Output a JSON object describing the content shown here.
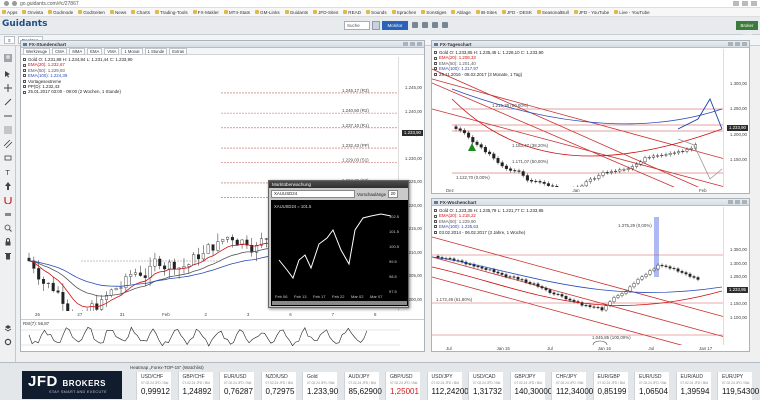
{
  "browser": {
    "url": "go.guidants.com/#c/27867",
    "bookmarks": [
      "Apps",
      "Onvista",
      "Godmode",
      "GodSeiten",
      "News",
      "Charts",
      "Trading-Tools",
      "FX-Makler",
      "MT4-Stats",
      "GM-Links",
      "Guidants",
      "JFD-Sites",
      "READ",
      "Sounds",
      "Sprachen",
      "Sonstiges",
      "Ablage",
      "IB-Sites",
      "JFD - DESK",
      "SeasonalBull",
      "JFD - YouTube",
      "Live - YouTube"
    ]
  },
  "app": {
    "logo": "Guidants",
    "search_placeholder": "Suche",
    "monitor_label": "Monitor",
    "broker_label": "Broker Login"
  },
  "toolbar": {
    "items": [
      "Desktop"
    ]
  },
  "panel_stunden": {
    "title": "FX-Stundenchart",
    "tools": [
      "Werkzeuge",
      "CMA",
      "MMA",
      "EMA",
      "VMA",
      "1 Monat",
      "1 Stunde",
      "Extras"
    ],
    "legend": [
      {
        "text": "Gold  O: 1.231,88  H: 1.234,84  L: 1.231,44  C: 1.233,90",
        "color": "#222222"
      },
      {
        "text": "EMA(20): 1.232,67",
        "color": "#d01010"
      },
      {
        "text": "EMA(50): 1.229,93",
        "color": "#555555"
      },
      {
        "text": "EMA(100): 1.224,39",
        "color": "#2a4ab8"
      },
      {
        "text": "Vortagesextreme",
        "color": "#222222"
      },
      {
        "text": "PP(D): 1.232,43",
        "color": "#222222"
      },
      {
        "text": "25.01.2017 03:00 - 09:00  (2 Wochen, 1 Stunde)",
        "color": "#222222"
      }
    ],
    "levels": [
      {
        "label": "1.245,17 (R3)",
        "value": 1245.17
      },
      {
        "label": "1.240,50 (R2)",
        "value": 1240.5
      },
      {
        "label": "1.237,10 (R1)",
        "value": 1237.1
      },
      {
        "label": "1.232,43 (PP)",
        "value": 1232.43
      },
      {
        "label": "1.229,03 (S1)",
        "value": 1229.03
      },
      {
        "label": "1.224,36 (S2)",
        "value": 1224.36
      },
      {
        "label": "1.220,96 (S3)",
        "value": 1220.96
      }
    ],
    "yticks": [
      "1.245,00",
      "1.240,00",
      "1.235,00",
      "1.230,00",
      "1.225,00",
      "1.220,00",
      "1.215,00",
      "1.210,00",
      "1.205,00",
      "1.200,00"
    ],
    "last": "1.233,90",
    "xticks": [
      "26",
      "27",
      "31",
      "Feb",
      "2",
      "3",
      "6",
      "7",
      "8"
    ],
    "rsi_label": "RSI(7): 56,87"
  },
  "panel_tages": {
    "title": "FX-Tageschart",
    "legend": [
      {
        "text": "Gold  O: 1.233,85  H: 1.235,45  L: 1.228,10  C: 1.233,90",
        "color": "#222222"
      },
      {
        "text": "EMA(20): 1.208,33",
        "color": "#d01010"
      },
      {
        "text": "EMA(50): 1.201,40",
        "color": "#555555"
      },
      {
        "text": "EMA(100): 1.217,97",
        "color": "#2a4ab8"
      },
      {
        "text": "28.11.2016 - 08.02.2017  (3 Monate, 1 Tag)",
        "color": "#222222"
      }
    ],
    "labels": [
      "1.215,38 (50,00%)",
      "1.183,47 (38,20%)",
      "1.171,07 (50,00%)",
      "1.122,70 (0,00%)"
    ],
    "yticks": [
      "1.300,00",
      "1.250,00",
      "1.200,00",
      "1.150,00"
    ],
    "last": "1.233,90",
    "xticks": [
      "Dez",
      "Jan",
      "Feb"
    ]
  },
  "panel_wochen": {
    "title": "FX-Wochenchart",
    "legend": [
      {
        "text": "Gold  O: 1.223,35  H: 1.235,79  L: 1.221,77  C: 1.233,95",
        "color": "#222222"
      },
      {
        "text": "EMA(20): 1.218,22",
        "color": "#d01010"
      },
      {
        "text": "EMA(50): 1.229,90",
        "color": "#555555"
      },
      {
        "text": "EMA(100): 1.235,63",
        "color": "#2a4ab8"
      },
      {
        "text": "03.02.2014 - 06.02.2017  (3 Jahre, 1 Woche)",
        "color": "#222222"
      }
    ],
    "labels": [
      "1.375,29 (0,00%)",
      "1.172,49 (61,80%)",
      "1.045,85 (100,00%)"
    ],
    "yticks": [
      "1.350,00",
      "1.300,00",
      "1.250,00",
      "1.200,00",
      "1.150,00",
      "1.100,00"
    ],
    "last": "1.233,95",
    "xticks": [
      "Jul",
      "Jan 15",
      "Jul",
      "Jan 16",
      "Jul",
      "Jan 17"
    ]
  },
  "popup": {
    "title": "Marktüberwachung",
    "symbol": "XAUUSD24",
    "lookback_label": "Vorschaulänge",
    "lookback_value": "20",
    "series_label": "XAUUSD24 = 101.5",
    "yticks": [
      "102.5",
      "101.5",
      "100.5",
      "99.5",
      "98.5",
      "97.5"
    ],
    "xticks": [
      "Feb 06",
      "Feb 13",
      "Feb 17",
      "Feb 22",
      "Mar 02",
      "Mar 07"
    ]
  },
  "bottom": {
    "heatmap_title": "Heatmap „Forex-TOP-15\" (Watchlist)",
    "brand": "JFD",
    "brand_word": "BROKERS",
    "tagline": "STAY SMART AND EXECUTE",
    "quotes": [
      {
        "sym": "USD/CHF",
        "sub": "07.02.24  JFD / Bid",
        "val": "0,99912",
        "red": false
      },
      {
        "sym": "GBP/CHF",
        "sub": "07.02.24  JFD / Bid",
        "val": "1,24892",
        "red": false
      },
      {
        "sym": "EUR/USD",
        "sub": "07.02.24  JFD / Bid",
        "val": "0,76287",
        "red": false
      },
      {
        "sym": "NZD/USD",
        "sub": "07.02.24  JFD / Bid",
        "val": "0,72975",
        "red": false
      },
      {
        "sym": "Gold",
        "sub": "07.02.24  JFD / Bid",
        "val": "1.233,90",
        "red": false
      },
      {
        "sym": "AUD/JPY",
        "sub": "07.02.24  JFD / Bid",
        "val": "85,62900",
        "red": false
      },
      {
        "sym": "GBP/USD",
        "sub": "07.02.24  JFD / Bid",
        "val": "1,25001",
        "red": true
      },
      {
        "sym": "USD/JPY",
        "sub": "07.02.24  JFD / Bid",
        "val": "112,24200",
        "red": false
      },
      {
        "sym": "USD/CAD",
        "sub": "07.02.24  JFD / Bid",
        "val": "1,31732",
        "red": false
      },
      {
        "sym": "GBP/JPY",
        "sub": "07.02.24  JFD / Bid",
        "val": "140,30000",
        "red": false
      },
      {
        "sym": "CHF/JPY",
        "sub": "07.02.24  JFD / Bid",
        "val": "112,34000",
        "red": false
      },
      {
        "sym": "EUR/GBP",
        "sub": "07.02.24  JFD / Bid",
        "val": "0,85199",
        "red": false
      },
      {
        "sym": "EUR/USD",
        "sub": "07.02.24  JFD / Bid",
        "val": "1,06504",
        "red": false
      },
      {
        "sym": "EUR/AUD",
        "sub": "07.02.24  JFD / Bid",
        "val": "1,39594",
        "red": false
      },
      {
        "sym": "EUR/JPY",
        "sub": "07.02.24  JFD / Bid",
        "val": "119,54300",
        "red": false
      }
    ]
  },
  "colors": {
    "ema20": "#d01010",
    "ema50": "#555555",
    "ema100": "#2a4ab8",
    "monitor": "#2a63b8",
    "brand_bg": "#111c2e"
  }
}
